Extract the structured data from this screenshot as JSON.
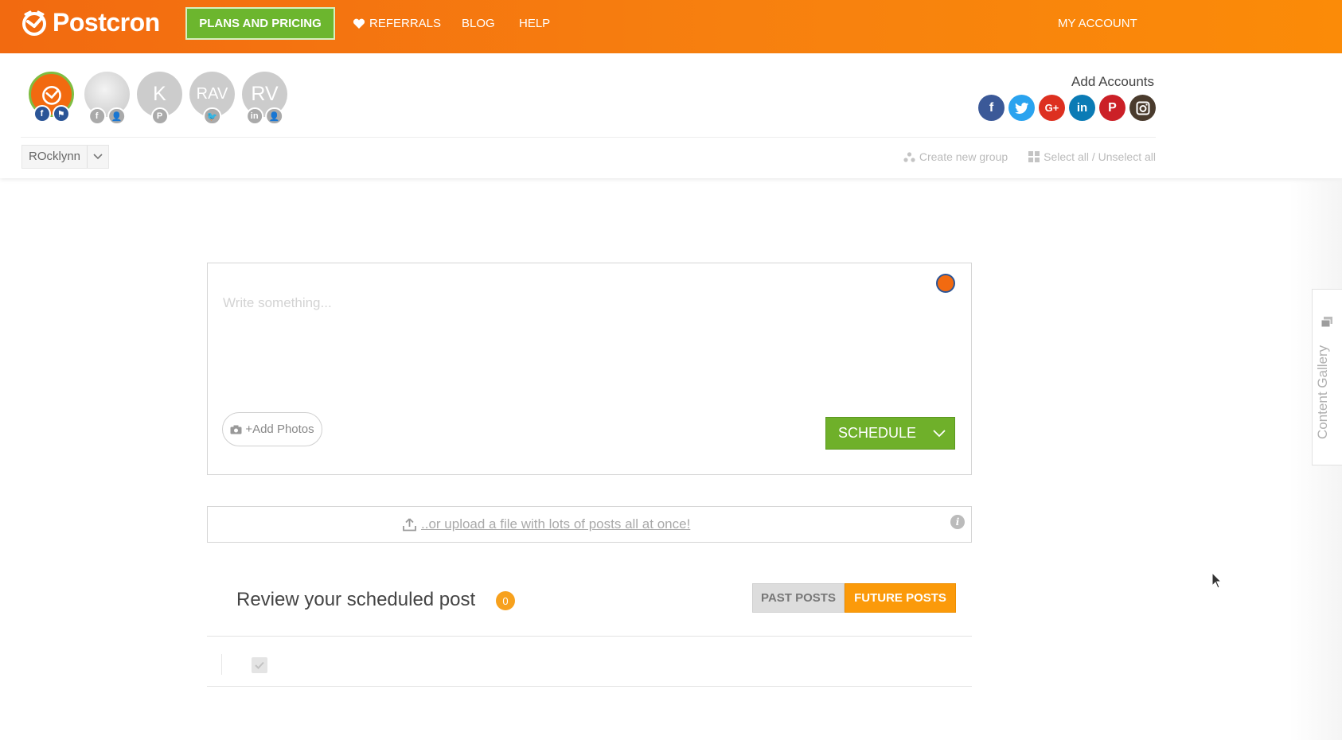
{
  "header": {
    "brand": "Postcron",
    "plans_label": "PLANS AND PRICING",
    "referrals_label": "REFERRALS",
    "blog_label": "BLOG",
    "help_label": "HELP",
    "account_label": "MY ACCOUNT"
  },
  "accounts": {
    "avatars": [
      {
        "initials": "",
        "badges": [
          "f",
          "⚑"
        ]
      },
      {
        "initials": "",
        "badges": [
          "f",
          "👤"
        ]
      },
      {
        "initials": "K",
        "badges": [
          "P"
        ]
      },
      {
        "initials": "RAV",
        "badges": [
          "🐦"
        ]
      },
      {
        "initials": "RV",
        "badges": [
          "in",
          "👤"
        ]
      }
    ],
    "add_accounts_label": "Add Accounts",
    "social_networks": [
      "facebook-icon",
      "twitter-icon",
      "google-plus-icon",
      "linkedin-icon",
      "pinterest-icon",
      "instagram-icon"
    ]
  },
  "groups": {
    "selected_group": "ROcklynn",
    "create_group_label": "Create new group",
    "select_all_label": "Select all / Unselect all"
  },
  "composer": {
    "placeholder": "Write something...",
    "add_photos_label": "+Add Photos",
    "schedule_label": "SCHEDULE"
  },
  "upload": {
    "link_label": "..or upload a file with lots of posts all at once!",
    "info_glyph": "i"
  },
  "review": {
    "title": "Review your scheduled post",
    "count": "0",
    "past_label": "PAST POSTS",
    "future_label": "FUTURE POSTS"
  },
  "gallery": {
    "label": "Content Gallery"
  },
  "colors": {
    "brand_orange": "#f7800f",
    "green": "#6fb02a",
    "future_tab": "#fb9a0a"
  }
}
